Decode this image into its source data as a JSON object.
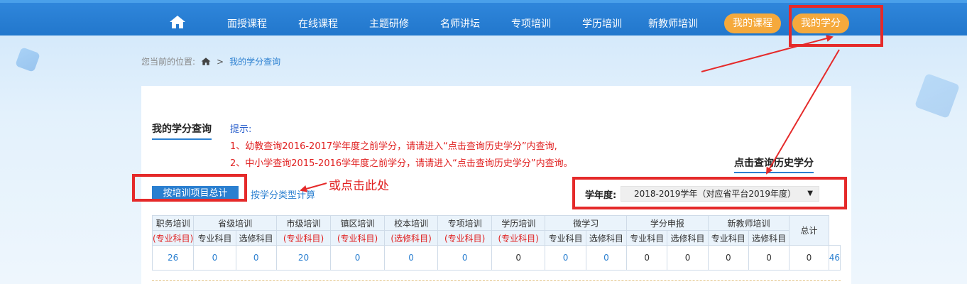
{
  "nav": {
    "items": [
      "面授课程",
      "在线课程",
      "主题研修",
      "名师讲坛",
      "专项培训",
      "学历培训",
      "新教师培训"
    ],
    "pill_my_courses": "我的课程",
    "pill_my_credits": "我的学分"
  },
  "breadcrumb": {
    "label": "您当前的位置:",
    "sep": ">",
    "current": "我的学分查询"
  },
  "panel": {
    "title": "我的学分查询",
    "tips_label": "提示:",
    "tip1": "1、幼教查询2016-2017学年度之前学分，请请进入“点击查询历史学分”内查询,",
    "tip2": "2、中小学查询2015-2016学年度之前学分，请请进入“点击查询历史学分”内查询。",
    "history_link": "点击查询历史学分",
    "btn_total": "按培训项目总计",
    "btn_type": "按学分类型计算",
    "annotation": "或点击此处",
    "year_label": "学年度:",
    "year_value": "2018-2019学年（对应省平台2019年度）"
  },
  "table": {
    "h1": [
      "职务培训",
      "省级培训",
      "市级培训",
      "镇区培训",
      "校本培训",
      "专项培训",
      "学历培训",
      "微学习",
      "学分申报",
      "新教师培训",
      "总计"
    ],
    "h2": [
      "(专业科目)",
      "专业科目",
      "选修科目",
      "(专业科目)",
      "(专业科目)",
      "(选修科目)",
      "(专业科目)",
      "(专业科目)",
      "专业科目",
      "选修科目",
      "专业科目",
      "选修科目",
      "专业科目",
      "选修科目"
    ],
    "values": [
      "26",
      "0",
      "0",
      "20",
      "0",
      "0",
      "0",
      "0",
      "0",
      "0",
      "0",
      "0",
      "0",
      "0",
      "0",
      "46"
    ]
  },
  "colors": {
    "nav_blue": "#2277cc",
    "pill_orange": "#f5a93c",
    "link_blue": "#2a7fd0",
    "annotation_red": "#e52a2a"
  }
}
